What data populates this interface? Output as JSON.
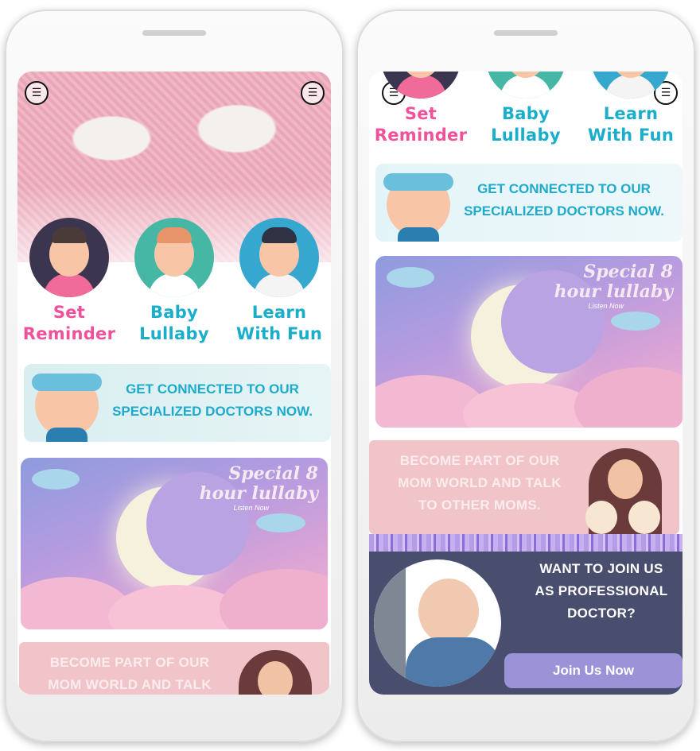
{
  "menu": {
    "icon": "hamburger-icon",
    "glyph": "☰"
  },
  "tiles": [
    {
      "label_line1": "Set",
      "label_line2": "Reminder",
      "color": "#f0519b",
      "icon": "baby-eating-icon"
    },
    {
      "label_line1": "Baby",
      "label_line2": "Lullaby",
      "color": "#1aaecb",
      "icon": "baby-pacifier-icon"
    },
    {
      "label_line1": "Learn",
      "label_line2": "With Fun",
      "color": "#1aaecb",
      "icon": "boy-learning-icon"
    }
  ],
  "doctor_banner": {
    "line1": "GET CONNECTED TO OUR",
    "line2": "SPECIALIZED DOCTORS NOW."
  },
  "lullaby": {
    "title_line1": "Special 8",
    "title_line2": "hour lullaby",
    "subtitle": "Listen Now"
  },
  "mom_world": {
    "line1": "BECOME PART OF OUR",
    "line2": "MOM WORLD AND TALK",
    "line3": "TO OTHER MOMS."
  },
  "join": {
    "line1": "WANT TO JOIN US",
    "line2": "AS PROFESSIONAL",
    "line3": "DOCTOR?",
    "button": "Join Us Now"
  },
  "colors": {
    "pink": "#f0519b",
    "teal": "#1aaecb",
    "navy": "#4a4e6e",
    "lavender": "#9b92d8"
  }
}
